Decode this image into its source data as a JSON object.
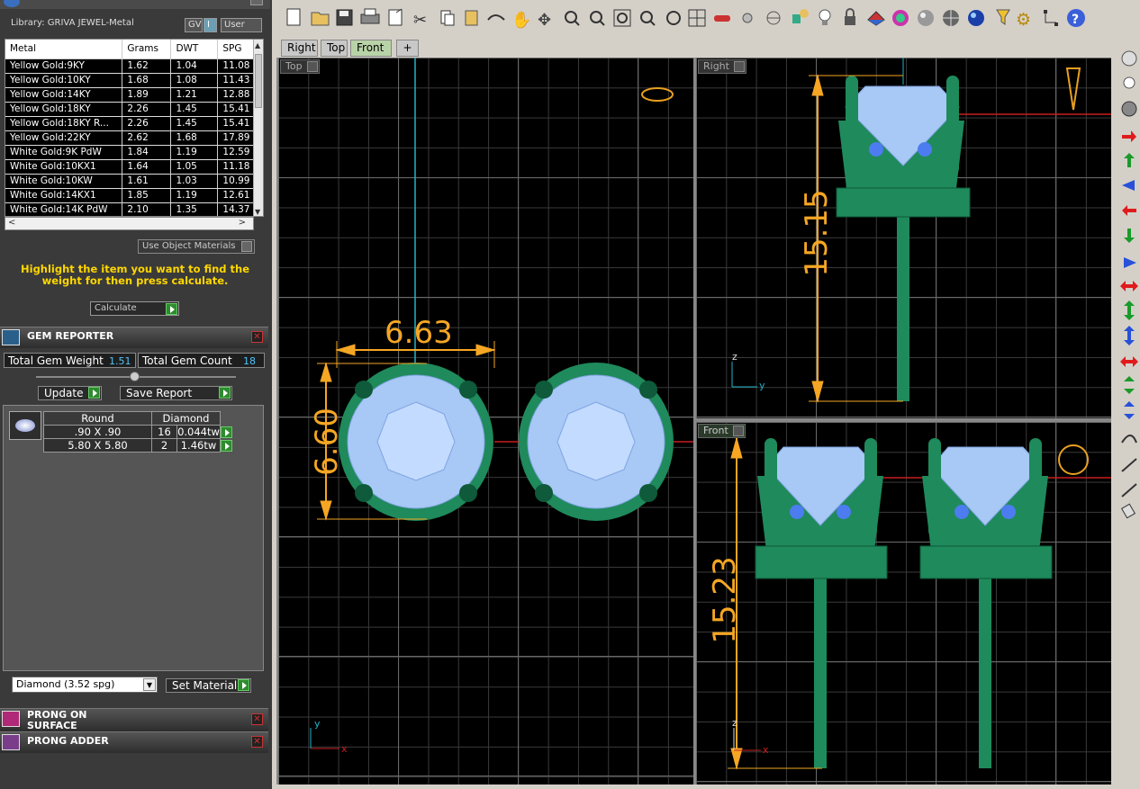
{
  "library": {
    "title": "Library: GRIVA JEWEL-Metal",
    "gv_label": "GV",
    "user_label": "User"
  },
  "metal_table": {
    "headers": [
      "Metal",
      "Grams",
      "DWT",
      "SPG"
    ],
    "rows": [
      [
        "Yellow Gold:9KY",
        "1.62",
        "1.04",
        "11.08"
      ],
      [
        "Yellow Gold:10KY",
        "1.68",
        "1.08",
        "11.43"
      ],
      [
        "Yellow Gold:14KY",
        "1.89",
        "1.21",
        "12.88"
      ],
      [
        "Yellow Gold:18KY",
        "2.26",
        "1.45",
        "15.41"
      ],
      [
        "Yellow Gold:18KY R...",
        "2.26",
        "1.45",
        "15.41"
      ],
      [
        "Yellow Gold:22KY",
        "2.62",
        "1.68",
        "17.89"
      ],
      [
        "White Gold:9K PdW",
        "1.84",
        "1.19",
        "12.59"
      ],
      [
        "White Gold:10KX1",
        "1.64",
        "1.05",
        "11.18"
      ],
      [
        "White Gold:10KW",
        "1.61",
        "1.03",
        "10.99"
      ],
      [
        "White Gold:14KX1",
        "1.85",
        "1.19",
        "12.61"
      ],
      [
        "White Gold:14K PdW",
        "2.10",
        "1.35",
        "14.37"
      ]
    ]
  },
  "use_object_materials": "Use Object Materials",
  "hint": "Highlight the item you want to find the weight for then press calculate.",
  "calculate_label": "Calculate",
  "gem_reporter": {
    "title": "GEM REPORTER",
    "total_weight_label": "Total Gem Weight",
    "total_weight_value": "1.51",
    "total_count_label": "Total Gem Count",
    "total_count_value": "18",
    "update_label": "Update",
    "save_report_label": "Save Report",
    "table_headers": [
      "Round",
      "Diamond"
    ],
    "rows": [
      {
        "size": ".90 X .90",
        "count": "16",
        "weight": "0.044tw"
      },
      {
        "size": "5.80 X 5.80",
        "count": "2",
        "weight": "1.46tw"
      }
    ],
    "material_select": "Diamond    (3.52 spg)",
    "set_material_label": "Set Material"
  },
  "prong_on_surface": {
    "title": "PRONG ON SURFACE"
  },
  "prong_adder": {
    "title": "PRONG ADDER"
  },
  "tabs": [
    "Right",
    "Top",
    "Front",
    "+"
  ],
  "viewports": {
    "top": {
      "label": "Top",
      "dim_width": "6.63",
      "dim_height": "6.60"
    },
    "right": {
      "label": "Right",
      "dim_height": "15.15"
    },
    "front": {
      "label": "Front",
      "dim_height": "15.23"
    }
  },
  "axes": {
    "x": "x",
    "y": "y",
    "z": "z"
  },
  "colors": {
    "dimension": "#f5a623",
    "model": "#1f8a5b",
    "gem": "#a8c8f5",
    "axis_cyan": "#1fb5c8",
    "axis_red": "#c81e1e"
  }
}
